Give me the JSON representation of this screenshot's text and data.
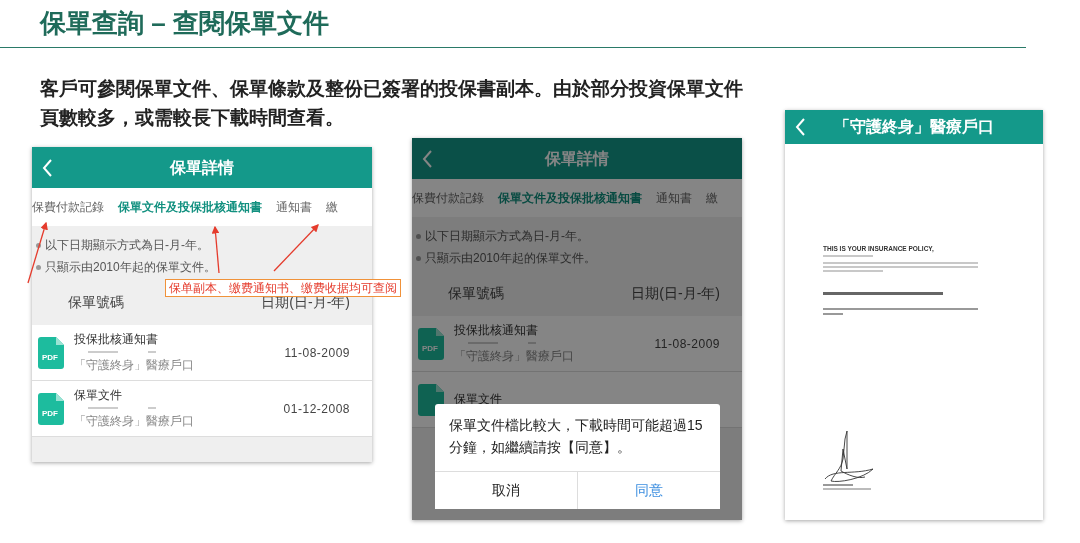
{
  "slide": {
    "title": "保單查詢 – 查閱保單文件",
    "description": "客戶可參閱保單文件、保單條款及整份已簽署的投保書副本。由於部分投資保單文件頁數較多，或需較長下載時間查看。"
  },
  "screens": [
    {
      "kind": "list",
      "dimmed": false,
      "header": {
        "title": "保單詳情"
      },
      "tabs": [
        {
          "label": "保費付款記錄",
          "selected": false
        },
        {
          "label": "保單文件及投保批核通知書",
          "selected": true
        },
        {
          "label": "通知書",
          "selected": false
        },
        {
          "label": "繳",
          "selected": false
        }
      ],
      "notes": [
        "以下日期顯示方式為日-月-年。",
        "只顯示由2010年起的保單文件。"
      ],
      "columns": [
        "保單號碼",
        "日期(日-月-年)"
      ],
      "rows": [
        {
          "icon_label": "PDF",
          "title": "投保批核通知書",
          "subtitle": "「守護終身」醫療戶口",
          "date": "11-08-2009"
        },
        {
          "icon_label": "PDF",
          "title": "保單文件",
          "subtitle": "「守護終身」醫療戶口",
          "date": "01-12-2008"
        }
      ],
      "annotation": {
        "text": "保单副本、缴费通知书、缴费收据均可查阅"
      }
    },
    {
      "kind": "list",
      "dimmed": true,
      "header": {
        "title": "保單詳情"
      },
      "tabs": [
        {
          "label": "保費付款記錄",
          "selected": false
        },
        {
          "label": "保單文件及投保批核通知書",
          "selected": true
        },
        {
          "label": "通知書",
          "selected": false
        },
        {
          "label": "繳",
          "selected": false
        }
      ],
      "notes": [
        "以下日期顯示方式為日-月-年。",
        "只顯示由2010年起的保單文件。"
      ],
      "columns": [
        "保單號碼",
        "日期(日-月-年)"
      ],
      "rows": [
        {
          "icon_label": "PDF",
          "title": "投保批核通知書",
          "subtitle": "「守護終身」醫療戶口",
          "date": "11-08-2009"
        },
        {
          "title": "保單文件"
        }
      ],
      "dialog": {
        "message": "保單文件檔比較大，下載時間可能超過15分鐘，如繼續請按【同意】。",
        "buttons": [
          {
            "label": "取消",
            "kind": "cancel"
          },
          {
            "label": "同意",
            "kind": "confirm"
          }
        ]
      }
    },
    {
      "kind": "document",
      "header": {
        "title": "「守護終身」醫療戶口"
      },
      "document": {
        "heading": "THIS IS YOUR INSURANCE POLICY,"
      }
    }
  ]
}
